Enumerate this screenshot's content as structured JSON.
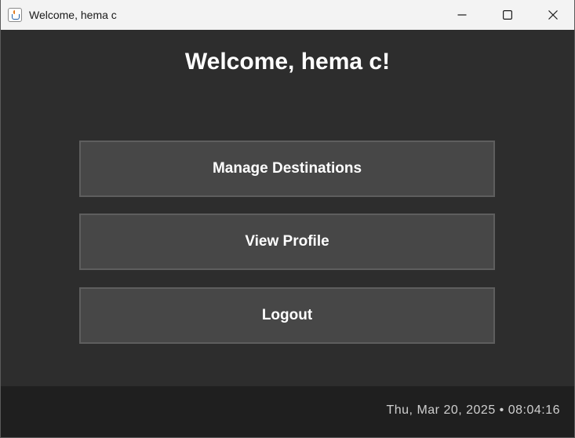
{
  "window": {
    "title": "Welcome, hema c"
  },
  "main": {
    "heading": "Welcome, hema c!",
    "buttons": [
      {
        "label": "Manage Destinations"
      },
      {
        "label": "View Profile"
      },
      {
        "label": "Logout"
      }
    ]
  },
  "footer": {
    "datetime": "Thu, Mar 20, 2025 • 08:04:16"
  },
  "colors": {
    "background": "#2d2d2d",
    "button": "#474747",
    "button_border": "#5e5e5e",
    "footer": "#1f1f1f",
    "titlebar": "#f3f3f3"
  },
  "icons": {
    "app": "java-coffee-cup-icon",
    "minimize": "minimize-icon",
    "maximize": "maximize-icon",
    "close": "close-icon"
  }
}
